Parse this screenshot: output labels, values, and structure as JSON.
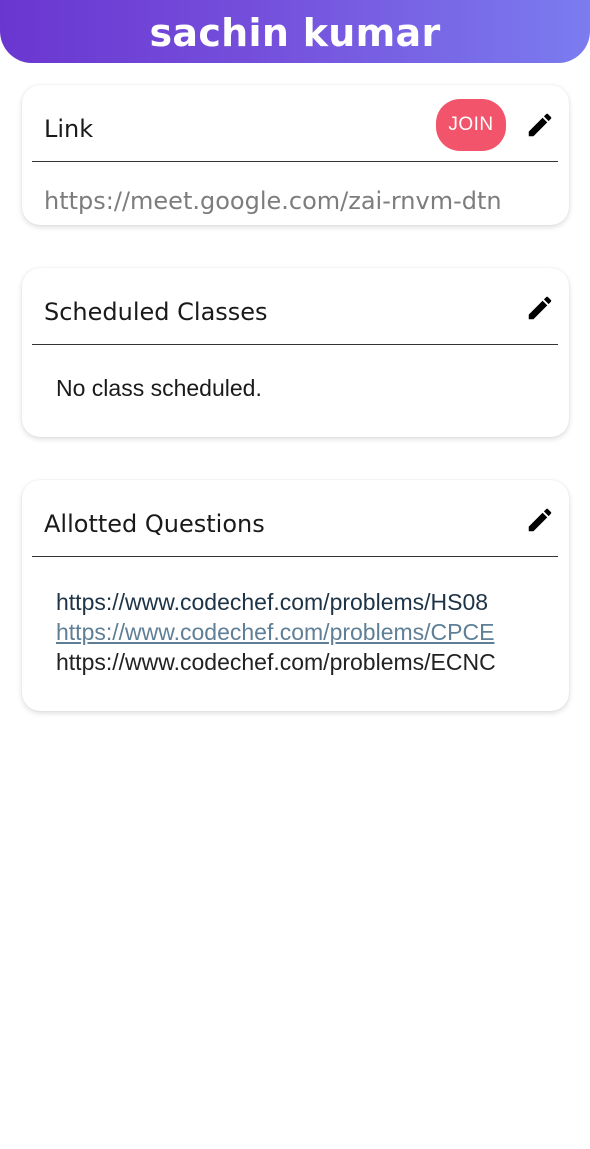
{
  "header": {
    "title": "sachin kumar"
  },
  "link_card": {
    "title": "Link",
    "join_label": "JOIN",
    "url": "https://meet.google.com/zai-rnvm-dtn"
  },
  "scheduled_card": {
    "title": "Scheduled Classes",
    "empty_message": "No class scheduled."
  },
  "questions_card": {
    "title": "Allotted Questions",
    "items": [
      "https://www.codechef.com/problems/HS08",
      "https://www.codechef.com/problems/CPCE",
      "https://www.codechef.com/problems/ECNC"
    ]
  },
  "colors": {
    "header_gradient_start": "#6a36d0",
    "header_gradient_end": "#7b7cef",
    "join_button": "#f2546b"
  },
  "icons": {
    "edit": "pencil-icon"
  }
}
